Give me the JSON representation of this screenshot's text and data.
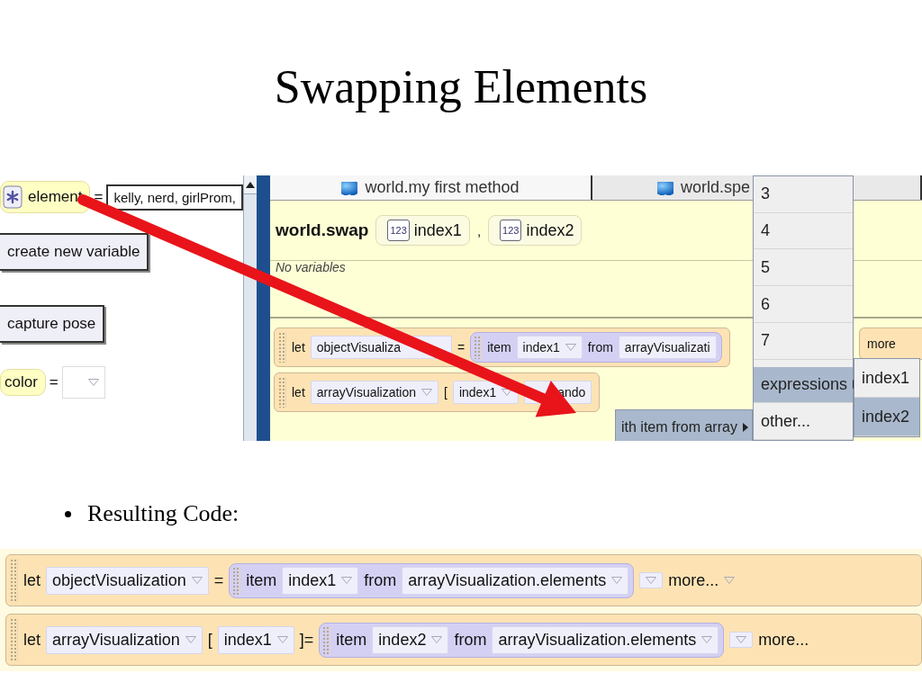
{
  "title": "Swapping Elements",
  "screenshot": {
    "properties": {
      "variable": {
        "name": "element",
        "operator": "=",
        "value": "kelly, nerd, girlProm,"
      },
      "buttons": [
        "create new variable",
        "capture pose"
      ],
      "property": {
        "name": "color",
        "operator": "="
      }
    },
    "editor": {
      "tabs": [
        {
          "label": "world.my first method",
          "selected": true
        },
        {
          "label": "world.spe",
          "selected": false
        }
      ],
      "method": {
        "name": "world.swap",
        "separator": ",",
        "params": [
          {
            "type": "123",
            "name": "index1"
          },
          {
            "type": "123",
            "name": "index2"
          }
        ]
      },
      "variables_note": "No variables",
      "statements": [
        {
          "parts": [
            {
              "kind": "keyword",
              "text": "let"
            },
            {
              "kind": "dropdown",
              "text": "objectVisualiza",
              "caret": false
            },
            {
              "kind": "keyword",
              "text": "="
            },
            {
              "kind": "expression",
              "parts": [
                {
                  "kind": "keyword",
                  "text": "item"
                },
                {
                  "kind": "dropdown",
                  "text": "index1",
                  "caret": true
                },
                {
                  "kind": "keyword",
                  "text": "from"
                },
                {
                  "kind": "dropdown",
                  "text": "arrayVisualizati",
                  "caret": false
                }
              ]
            },
            {
              "kind": "more",
              "text": "more",
              "caret": false
            }
          ]
        },
        {
          "parts": [
            {
              "kind": "keyword",
              "text": "let"
            },
            {
              "kind": "dropdown",
              "text": "arrayVisualization",
              "caret": true
            },
            {
              "kind": "keyword",
              "text": "["
            },
            {
              "kind": "dropdown",
              "text": "index1",
              "caret": true
            },
            {
              "kind": "dropdown",
              "text": "ando",
              "caret": false
            }
          ]
        }
      ]
    },
    "menus": [
      {
        "items": [
          {
            "label": "3",
            "submenu": false,
            "selected": false
          },
          {
            "label": "4",
            "submenu": false,
            "selected": false
          },
          {
            "label": "5",
            "submenu": false,
            "selected": false
          },
          {
            "label": "6",
            "submenu": false,
            "selected": false
          },
          {
            "label": "7",
            "submenu": false,
            "selected": false
          },
          {
            "label": "expressions",
            "submenu": true,
            "selected": true
          },
          {
            "label": "other...",
            "submenu": false,
            "selected": false
          }
        ]
      },
      {
        "items": [
          {
            "label": "index1",
            "submenu": false,
            "selected": false
          },
          {
            "label": "index2",
            "submenu": false,
            "selected": true
          }
        ]
      },
      {
        "items": [
          {
            "label": "ith item from array",
            "submenu": true,
            "selected": true
          }
        ]
      }
    ]
  },
  "bullets": [
    "Resulting Code:"
  ],
  "resulting_code": [
    {
      "parts": [
        {
          "kind": "keyword",
          "text": "let"
        },
        {
          "kind": "dropdown",
          "text": "objectVisualization",
          "caret": true
        },
        {
          "kind": "keyword",
          "text": "="
        },
        {
          "kind": "expression",
          "parts": [
            {
              "kind": "keyword",
              "text": "item"
            },
            {
              "kind": "dropdown",
              "text": "index1",
              "caret": true
            },
            {
              "kind": "keyword",
              "text": "from"
            },
            {
              "kind": "dropdown",
              "text": "arrayVisualization.elements",
              "caret": true
            }
          ]
        },
        {
          "kind": "caret"
        },
        {
          "kind": "more",
          "text": "more...",
          "caret": true
        }
      ]
    },
    {
      "parts": [
        {
          "kind": "keyword",
          "text": "let"
        },
        {
          "kind": "dropdown",
          "text": "arrayVisualization",
          "caret": true
        },
        {
          "kind": "keyword",
          "text": "["
        },
        {
          "kind": "dropdown",
          "text": "index1",
          "caret": true
        },
        {
          "kind": "keyword",
          "text": "]="
        },
        {
          "kind": "expression",
          "parts": [
            {
              "kind": "keyword",
              "text": "item"
            },
            {
              "kind": "dropdown",
              "text": "index2",
              "caret": true
            },
            {
              "kind": "keyword",
              "text": "from"
            },
            {
              "kind": "dropdown",
              "text": "arrayVisualization.elements",
              "caret": true
            }
          ]
        },
        {
          "kind": "caret"
        },
        {
          "kind": "more",
          "text": "more...",
          "caret": false
        }
      ]
    }
  ]
}
